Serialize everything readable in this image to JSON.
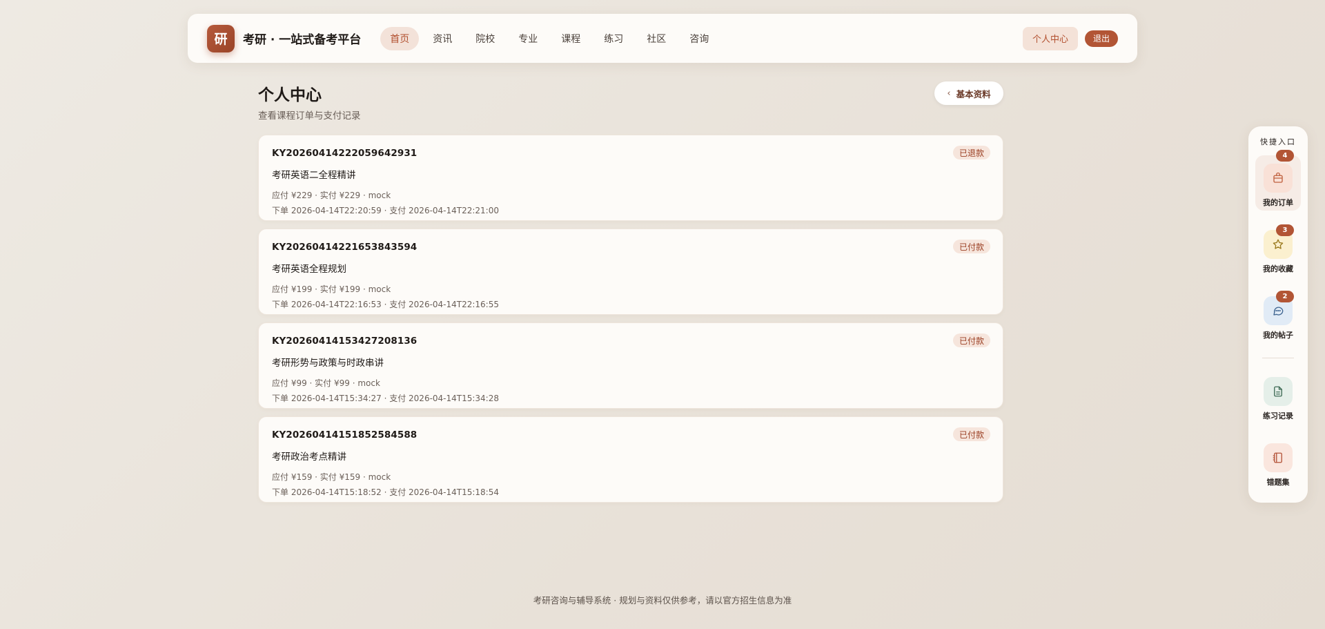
{
  "header": {
    "logo_text": "研",
    "brand": "考研 · 一站式备考平台",
    "nav": [
      {
        "label": "首页",
        "active": true
      },
      {
        "label": "资讯"
      },
      {
        "label": "院校"
      },
      {
        "label": "专业"
      },
      {
        "label": "课程"
      },
      {
        "label": "练习"
      },
      {
        "label": "社区"
      },
      {
        "label": "咨询"
      }
    ],
    "center_label": "个人中心",
    "logout_label": "退出"
  },
  "page": {
    "title": "个人中心",
    "subtitle": "查看课程订单与支付记录",
    "back_label": "基本资料"
  },
  "orders": [
    {
      "no": "KY20260414222059642931",
      "course": "考研英语二全程精讲",
      "amount": "应付 ¥229 · 实付 ¥229 · mock",
      "time": "下单 2026-04-14T22:20:59 · 支付 2026-04-14T22:21:00",
      "status": "已退款"
    },
    {
      "no": "KY20260414221653843594",
      "course": "考研英语全程规划",
      "amount": "应付 ¥199 · 实付 ¥199 · mock",
      "time": "下单 2026-04-14T22:16:53 · 支付 2026-04-14T22:16:55",
      "status": "已付款"
    },
    {
      "no": "KY20260414153427208136",
      "course": "考研形势与政策与时政串讲",
      "amount": "应付 ¥99 · 实付 ¥99 · mock",
      "time": "下单 2026-04-14T15:34:27 · 支付 2026-04-14T15:34:28",
      "status": "已付款"
    },
    {
      "no": "KY20260414151852584588",
      "course": "考研政治考点精讲",
      "amount": "应付 ¥159 · 实付 ¥159 · mock",
      "time": "下单 2026-04-14T15:18:52 · 支付 2026-04-14T15:18:54",
      "status": "已付款"
    }
  ],
  "quick": {
    "title": "快捷入口",
    "items": [
      {
        "label": "我的订单",
        "badge": "4",
        "icon": "bag-icon"
      },
      {
        "label": "我的收藏",
        "badge": "3",
        "icon": "star-icon"
      },
      {
        "label": "我的帖子",
        "badge": "2",
        "icon": "chat-icon"
      },
      {
        "label": "练习记录",
        "icon": "document-icon"
      },
      {
        "label": "错题集",
        "icon": "notebook-icon"
      }
    ]
  },
  "footer": "考研咨询与辅导系统 · 规划与资料仅供参考，请以官方招生信息为准",
  "colors": {
    "accent": "#b25535",
    "accent_light": "#f3e2d9",
    "background": "#ebe5dd"
  }
}
